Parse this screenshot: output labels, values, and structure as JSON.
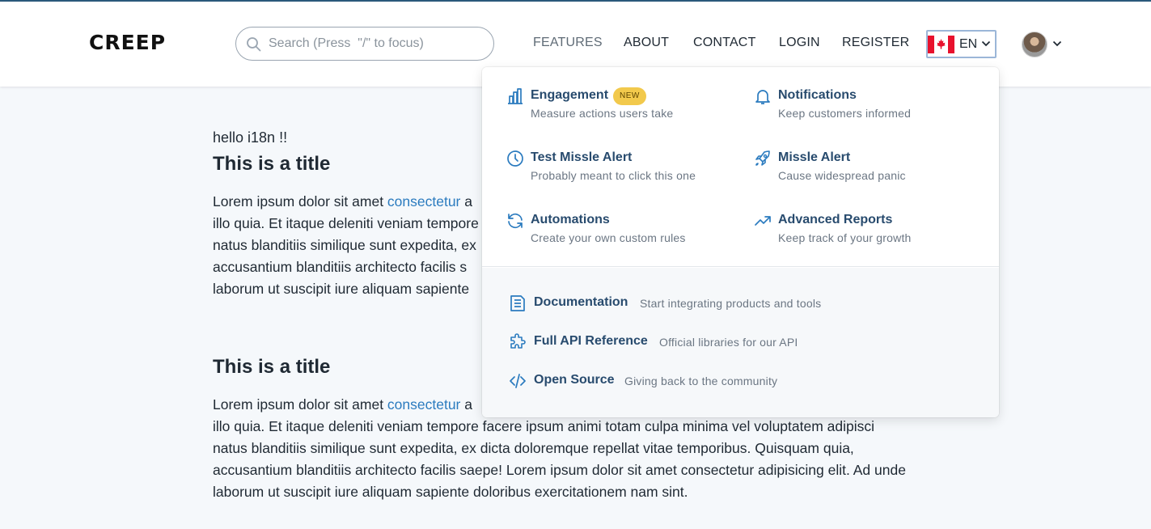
{
  "brand": {
    "logo": "CREEP"
  },
  "search": {
    "placeholder": "Search (Press  \"/\" to focus)"
  },
  "nav": {
    "features": "FEATURES",
    "about": "ABOUT",
    "contact": "CONTACT",
    "login": "LOGIN",
    "register": "REGISTER"
  },
  "language": {
    "code": "EN",
    "flag_icon": "canada-flag-icon"
  },
  "content": {
    "hello": "hello i18n !!",
    "sections": [
      {
        "title": "This is a title",
        "link": "consectetur",
        "para_start": "Lorem ipsum dolor sit amet ",
        "line1_end": " a",
        "line2": "illo quia. Et itaque deleniti veniam tempore",
        "line3": "natus blanditiis similique sunt expedita, ex",
        "line4": "accusantium blanditiis architecto facilis s",
        "line5": "laborum ut suscipit iure aliquam sapiente"
      },
      {
        "title": "This is a title",
        "link": "consectetur",
        "para_start": "Lorem ipsum dolor sit amet ",
        "line1_end": " a",
        "line2": "illo quia. Et itaque deleniti veniam tempore facere ipsum animi totam culpa minima vel voluptatem adipisci",
        "line3": "natus blanditiis similique sunt expedita, ex dicta doloremque repellat vitae temporibus. Quisquam quia,",
        "line4": "accusantium blanditiis architecto facilis saepe! Lorem ipsum dolor sit amet consectetur adipisicing elit. Ad unde",
        "line5": "laborum ut suscipit iure aliquam sapiente doloribus exercitationem nam sint."
      }
    ]
  },
  "dropdown": {
    "features": [
      {
        "title": "Engagement",
        "desc": "Measure actions users take",
        "badge": "NEW",
        "icon": "bar-chart-icon"
      },
      {
        "title": "Notifications",
        "desc": "Keep customers informed",
        "icon": "bell-icon"
      },
      {
        "title": "Test Missle Alert",
        "desc": "Probably meant to click this one",
        "icon": "clock-icon"
      },
      {
        "title": "Missle Alert",
        "desc": "Cause widespread panic",
        "icon": "rocket-icon"
      },
      {
        "title": "Automations",
        "desc": "Create your own custom rules",
        "icon": "refresh-icon"
      },
      {
        "title": "Advanced Reports",
        "desc": "Keep track of your growth",
        "icon": "trending-up-icon"
      }
    ],
    "resources": [
      {
        "title": "Documentation",
        "desc": "Start integrating products and tools",
        "icon": "document-icon"
      },
      {
        "title": "Full API Reference",
        "desc": "Official libraries for our API",
        "icon": "puzzle-icon"
      },
      {
        "title": "Open Source",
        "desc": "Giving back to the community",
        "icon": "code-icon"
      }
    ]
  },
  "colors": {
    "accent": "#2b7bbf",
    "menu_title": "#284b6e",
    "badge": "#f2c94c",
    "page_bg": "#f5f8fb"
  }
}
